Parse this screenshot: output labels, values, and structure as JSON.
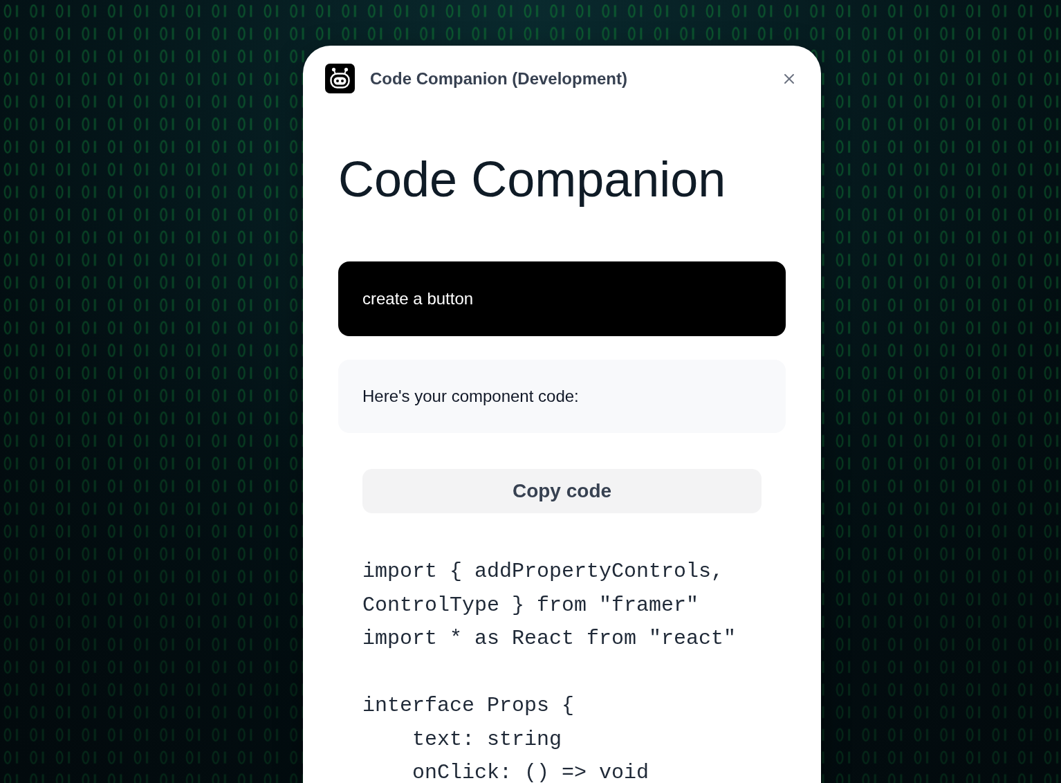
{
  "window": {
    "title": "Code Companion (Development)"
  },
  "heading": "Code Companion",
  "messages": [
    {
      "kind": "user",
      "text": "create a button"
    },
    {
      "kind": "assistant",
      "text": "Here's your component code:"
    }
  ],
  "copy_button": {
    "label": "Copy code"
  },
  "code": "import { addPropertyControls,\nControlType } from \"framer\"\nimport * as React from \"react\"\n\ninterface Props {\n    text: string\n    onClick: () => void"
}
